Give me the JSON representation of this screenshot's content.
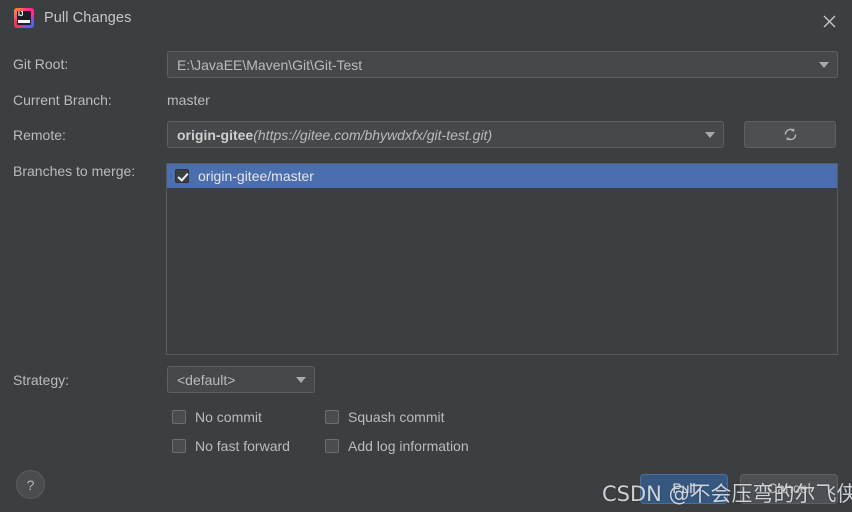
{
  "window": {
    "title": "Pull Changes",
    "app_icon": "intellij-idea-icon",
    "close_icon": "close-icon"
  },
  "form": {
    "git_root": {
      "label": "Git Root:",
      "value": "E:\\JavaEE\\Maven\\Git\\Git-Test",
      "arrow_icon": "chevron-down-icon"
    },
    "current_branch": {
      "label": "Current Branch:",
      "value": "master"
    },
    "remote": {
      "label": "Remote:",
      "name": "origin-gitee",
      "url": "(https://gitee.com/bhywdxfx/git-test.git)",
      "arrow_icon": "chevron-down-icon",
      "refresh_icon": "refresh-icon"
    },
    "branches_to_merge": {
      "label": "Branches to merge:",
      "items": [
        {
          "name": "origin-gitee/master",
          "checked": true,
          "selected": true
        }
      ]
    },
    "strategy": {
      "label": "Strategy:",
      "value": "<default>",
      "arrow_icon": "chevron-down-icon",
      "options": [
        {
          "label": "No commit",
          "checked": false
        },
        {
          "label": "No fast forward",
          "checked": false
        },
        {
          "label": "Squash commit",
          "checked": false
        },
        {
          "label": "Add log information",
          "checked": false
        }
      ]
    }
  },
  "footer": {
    "help_label": "?",
    "pull_label": "Pull",
    "cancel_label": "Cancel"
  },
  "watermark": {
    "text": "CSDN @不会压弯的尔飞侠"
  },
  "colors": {
    "background": "#3c3f41",
    "field_background": "#45494a",
    "selection_blue": "#4b6eaf",
    "primary_button": "#365880",
    "text": "#bbbbbb"
  }
}
